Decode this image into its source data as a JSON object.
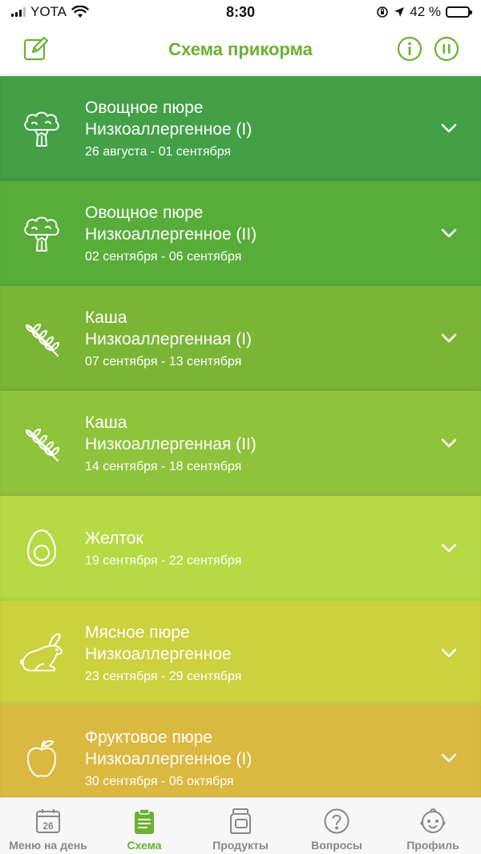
{
  "status_bar": {
    "carrier": "YOTA",
    "time": "8:30",
    "battery_text": "42 %",
    "battery_level": 0.42
  },
  "header": {
    "title": "Схема прикорма"
  },
  "stages": [
    {
      "name_line1": "Овощное пюре",
      "name_line2": "Низкоаллергенное (I)",
      "dates": "26 августа - 01 сентября",
      "color": "#43a047",
      "icon": "broccoli-icon"
    },
    {
      "name_line1": "Овощное пюре",
      "name_line2": "Низкоаллергенное (II)",
      "dates": "02 сентября - 06 сентября",
      "color": "#58ad3a",
      "icon": "broccoli-icon"
    },
    {
      "name_line1": "Каша",
      "name_line2": "Низкоаллергенная (I)",
      "dates": "07 сентября - 13 сентября",
      "color": "#7bb536",
      "icon": "wheat-icon"
    },
    {
      "name_line1": "Каша",
      "name_line2": "Низкоаллергенная (II)",
      "dates": "14 сентября - 18 сентября",
      "color": "#8fc33b",
      "icon": "wheat-icon"
    },
    {
      "name_line1": "Желток",
      "name_line2": "",
      "dates": "19 сентября - 22 сентября",
      "color": "#b6da43",
      "icon": "egg-icon"
    },
    {
      "name_line1": "Мясное пюре",
      "name_line2": "Низкоаллергенное",
      "dates": "23 сентября - 29 сентября",
      "color": "#ccd13e",
      "icon": "rabbit-icon"
    },
    {
      "name_line1": "Фруктовое пюре",
      "name_line2": "Низкоаллергенное (I)",
      "dates": "30 сентября - 06 октября",
      "color": "#dbb83f",
      "icon": "apple-icon"
    }
  ],
  "tabs": [
    {
      "label": "Меню на день",
      "icon": "calendar-icon",
      "calendar_day": "26",
      "active": false
    },
    {
      "label": "Схема",
      "icon": "clipboard-icon",
      "active": true
    },
    {
      "label": "Продукты",
      "icon": "jar-icon",
      "active": false
    },
    {
      "label": "Вопросы",
      "icon": "question-icon",
      "active": false
    },
    {
      "label": "Профиль",
      "icon": "baby-face-icon",
      "active": false
    }
  ],
  "colors": {
    "accent": "#6ab231",
    "tab_inactive": "#888888"
  }
}
